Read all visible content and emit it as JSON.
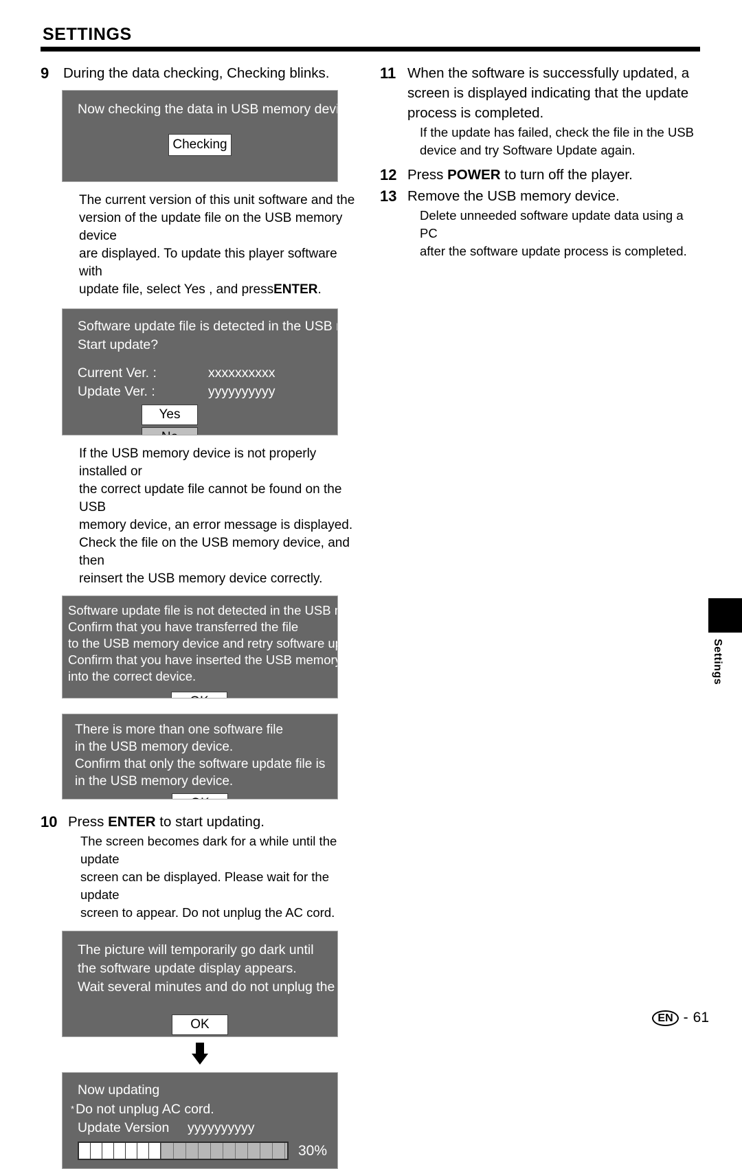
{
  "header": {
    "title": "SETTINGS"
  },
  "left_column": {
    "step9": {
      "number": "9",
      "text": "During the data checking,  Checking  blinks."
    },
    "dialog_checking": {
      "line1": "Now checking the data in USB memory device.",
      "button": "Checking"
    },
    "para_versions": {
      "line1": "The current version of this unit software and the",
      "line2": "version of the update file on the USB memory device",
      "line3": "are displayed. To update this player software with",
      "line4_a": "update file, select  Yes , and press",
      "line4_b": "ENTER",
      "line4_c": "."
    },
    "dialog_start_update": {
      "line1": "Software update file is detected in the USB memory",
      "line2": "Start update?",
      "current_ver_label": "Current Ver. :",
      "current_ver_value": "xxxxxxxxxx",
      "update_ver_label": "Update Ver. :",
      "update_ver_value": "yyyyyyyyyy",
      "button_yes": "Yes",
      "button_no": "No"
    },
    "para_error": {
      "line1": "If the USB memory device is not properly installed or",
      "line2": "the correct update file cannot be found on the USB",
      "line3": "memory device, an error message is displayed.",
      "line4": "Check the file on the USB memory device, and then",
      "line5": "reinsert the USB memory device correctly."
    },
    "dialog_not_detected": {
      "line1": "Software update file is not detected in the USB memo",
      "line2": "Confirm that you have transferred the file",
      "line3": "to the USB memory device and retry software update.",
      "line4": "Confirm that you have inserted the USB memory device",
      "line5": "into the correct device.",
      "button": "OK"
    },
    "dialog_more_than_one": {
      "line1": "There is more than one software file",
      "line2": "in the USB memory device.",
      "line3": "Confirm that only the software update file is",
      "line4": "in the USB memory device.",
      "button": "OK"
    },
    "step10": {
      "number": "10",
      "text_a": "Press ",
      "text_b": "ENTER",
      "text_c": " to start updating.",
      "note1": "The screen becomes dark for a while until the update",
      "note2": "screen can be displayed. Please wait for the update",
      "note3": "screen to appear. Do not unplug the AC cord."
    },
    "dialog_go_dark": {
      "line1": "The picture will temporarily go dark until",
      "line2": "the software update display appears.",
      "line3": "Wait several minutes and do not unplug the AC",
      "button": "OK"
    },
    "dialog_now_updating": {
      "line1": "Now updating",
      "line2_bullet": "*",
      "line2": "Do not unplug AC cord.",
      "version_label": "Update Version",
      "version_value": "yyyyyyyyyy",
      "progress_percent": "30%",
      "progress_value": 30,
      "progress_segments": 7
    }
  },
  "right_column": {
    "step11": {
      "number": "11",
      "line1": "When the software is successfully updated, a",
      "line2": "screen is displayed indicating that the update",
      "line3": "process is completed.",
      "note1": "If the update has failed, check the file in the USB",
      "note2": "device and try Software Update again."
    },
    "step12": {
      "number": "12",
      "text_a": "Press ",
      "text_b": "POWER",
      "text_c": " to turn off the player."
    },
    "step13": {
      "number": "13",
      "text": "Remove the USB memory device.",
      "note1": "Delete unneeded software update data using a PC",
      "note2": "after the software update process is completed."
    }
  },
  "side_tab": {
    "label": "Settings"
  },
  "footer": {
    "language": "EN",
    "separator": "-",
    "page_number": "61"
  },
  "colors": {
    "osd_background": "#676767",
    "osd_border": "#a9a9a9",
    "button_selected": "#ffffff",
    "button_unselected": "#bfbfbf",
    "progress_unfilled": "#b7b7b7",
    "text": "#000000",
    "osd_text": "#ffffff"
  }
}
